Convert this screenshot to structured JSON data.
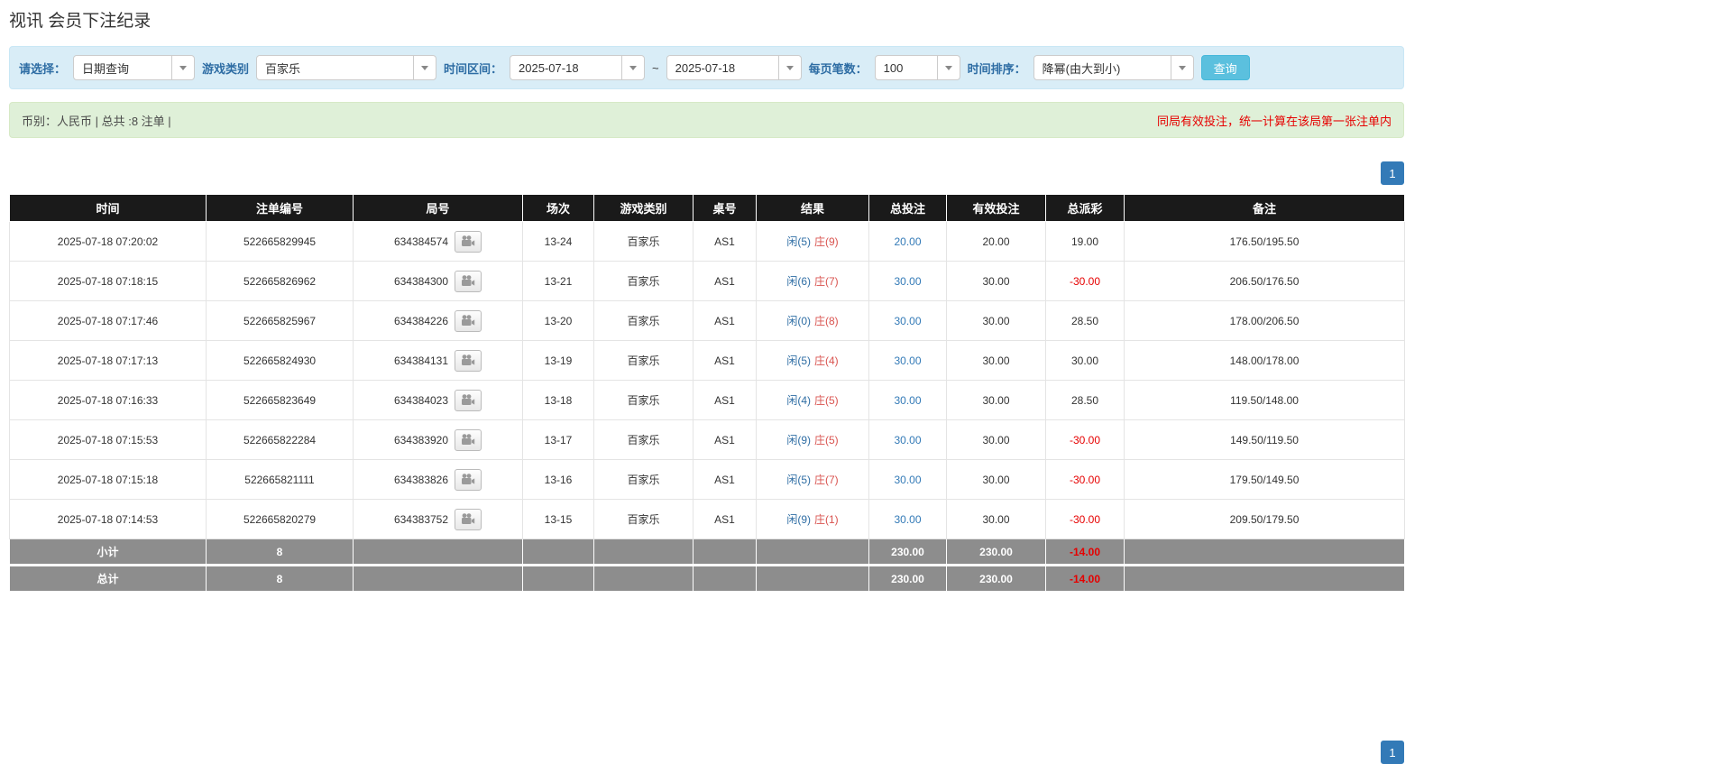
{
  "page": {
    "title": "视讯 会员下注纪录"
  },
  "filter_bar": {
    "select_label": "请选择：",
    "query_type_value": "日期查询",
    "game_category_label": "游戏类别",
    "game_category_value": "百家乐",
    "time_range_label": "时间区间：",
    "date_from_value": "2025-07-18",
    "range_separator": "~",
    "date_to_value": "2025-07-18",
    "page_size_label": "每页笔数：",
    "page_size_value": "100",
    "time_sort_label": "时间排序：",
    "time_sort_value": "降幂(由大到小)",
    "search_button_label": "查询"
  },
  "summary_bar": {
    "currency_info": "币别：人民币 | 总共 :8 注单 |",
    "notice": "同局有效投注，统一计算在该局第一张注单内"
  },
  "pagination": {
    "current_page": "1"
  },
  "table": {
    "headers": [
      "时间",
      "注单编号",
      "局号",
      "场次",
      "游戏类别",
      "桌号",
      "结果",
      "总投注",
      "有效投注",
      "总派彩",
      "备注"
    ],
    "rows": [
      {
        "time": "2025-07-18 07:20:02",
        "bet_id": "522665829945",
        "round_id": "634384574",
        "session": "13-24",
        "game": "百家乐",
        "table_no": "AS1",
        "result_player": "闲(5)",
        "result_banker": "庄(9)",
        "total_bet": "20.00",
        "valid_bet": "20.00",
        "payout": "19.00",
        "remark": "176.50/195.50"
      },
      {
        "time": "2025-07-18 07:18:15",
        "bet_id": "522665826962",
        "round_id": "634384300",
        "session": "13-21",
        "game": "百家乐",
        "table_no": "AS1",
        "result_player": "闲(6)",
        "result_banker": "庄(7)",
        "total_bet": "30.00",
        "valid_bet": "30.00",
        "payout": "-30.00",
        "remark": "206.50/176.50"
      },
      {
        "time": "2025-07-18 07:17:46",
        "bet_id": "522665825967",
        "round_id": "634384226",
        "session": "13-20",
        "game": "百家乐",
        "table_no": "AS1",
        "result_player": "闲(0)",
        "result_banker": "庄(8)",
        "total_bet": "30.00",
        "valid_bet": "30.00",
        "payout": "28.50",
        "remark": "178.00/206.50"
      },
      {
        "time": "2025-07-18 07:17:13",
        "bet_id": "522665824930",
        "round_id": "634384131",
        "session": "13-19",
        "game": "百家乐",
        "table_no": "AS1",
        "result_player": "闲(5)",
        "result_banker": "庄(4)",
        "total_bet": "30.00",
        "valid_bet": "30.00",
        "payout": "30.00",
        "remark": "148.00/178.00"
      },
      {
        "time": "2025-07-18 07:16:33",
        "bet_id": "522665823649",
        "round_id": "634384023",
        "session": "13-18",
        "game": "百家乐",
        "table_no": "AS1",
        "result_player": "闲(4)",
        "result_banker": "庄(5)",
        "total_bet": "30.00",
        "valid_bet": "30.00",
        "payout": "28.50",
        "remark": "119.50/148.00"
      },
      {
        "time": "2025-07-18 07:15:53",
        "bet_id": "522665822284",
        "round_id": "634383920",
        "session": "13-17",
        "game": "百家乐",
        "table_no": "AS1",
        "result_player": "闲(9)",
        "result_banker": "庄(5)",
        "total_bet": "30.00",
        "valid_bet": "30.00",
        "payout": "-30.00",
        "remark": "149.50/119.50"
      },
      {
        "time": "2025-07-18 07:15:18",
        "bet_id": "522665821111",
        "round_id": "634383826",
        "session": "13-16",
        "game": "百家乐",
        "table_no": "AS1",
        "result_player": "闲(5)",
        "result_banker": "庄(7)",
        "total_bet": "30.00",
        "valid_bet": "30.00",
        "payout": "-30.00",
        "remark": "179.50/149.50"
      },
      {
        "time": "2025-07-18 07:14:53",
        "bet_id": "522665820279",
        "round_id": "634383752",
        "session": "13-15",
        "game": "百家乐",
        "table_no": "AS1",
        "result_player": "闲(9)",
        "result_banker": "庄(1)",
        "total_bet": "30.00",
        "valid_bet": "30.00",
        "payout": "-30.00",
        "remark": "209.50/179.50"
      }
    ],
    "subtotal_row": {
      "label": "小计",
      "count": "8",
      "total_bet": "230.00",
      "valid_bet": "230.00",
      "payout": "-14.00"
    },
    "total_row": {
      "label": "总计",
      "count": "8",
      "total_bet": "230.00",
      "valid_bet": "230.00",
      "payout": "-14.00"
    }
  },
  "colors": {
    "accent_blue": "#337ab7",
    "player_blue": "#2e6da4",
    "banker_red": "#d9534f",
    "negative_red": "#e60000",
    "filter_bg": "#d9edf7",
    "summary_bg": "#dff0d8",
    "header_bg": "#1a1a1a",
    "footer_bg": "#8d8d8d"
  }
}
